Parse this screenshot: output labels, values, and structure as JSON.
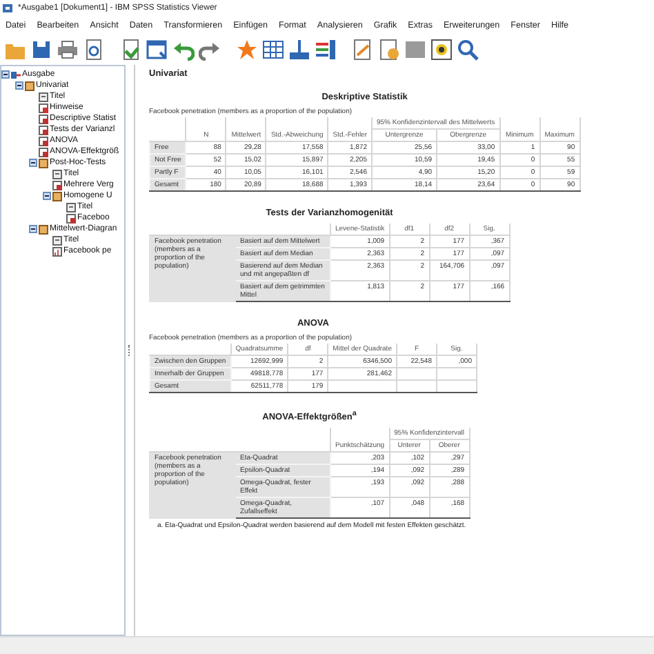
{
  "window": {
    "title": "*Ausgabe1 [Dokument1] - IBM SPSS Statistics Viewer"
  },
  "menu": [
    "Datei",
    "Bearbeiten",
    "Ansicht",
    "Daten",
    "Transformieren",
    "Einfügen",
    "Format",
    "Analysieren",
    "Grafik",
    "Extras",
    "Erweiterungen",
    "Fenster",
    "Hilfe"
  ],
  "outline": [
    {
      "label": "Ausgabe",
      "kind": "root",
      "expanded": true,
      "children": [
        {
          "label": "Univariat",
          "kind": "folder",
          "expanded": true,
          "children": [
            {
              "label": "Titel",
              "kind": "title"
            },
            {
              "label": "Hinweise",
              "kind": "notes"
            },
            {
              "label": "Descriptive Statist",
              "kind": "table"
            },
            {
              "label": "Tests der Varianzl",
              "kind": "table"
            },
            {
              "label": "ANOVA",
              "kind": "table"
            },
            {
              "label": "ANOVA-Effektgröß",
              "kind": "table"
            },
            {
              "label": "Post-Hoc-Tests",
              "kind": "folder",
              "expanded": true,
              "children": [
                {
                  "label": "Titel",
                  "kind": "title"
                },
                {
                  "label": "Mehrere Verg",
                  "kind": "table"
                },
                {
                  "label": "Homogene U",
                  "kind": "folder",
                  "expanded": true,
                  "children": [
                    {
                      "label": "Titel",
                      "kind": "title"
                    },
                    {
                      "label": "Faceboo",
                      "kind": "table"
                    }
                  ]
                }
              ]
            },
            {
              "label": "Mittelwert-Diagran",
              "kind": "folder",
              "expanded": true,
              "children": [
                {
                  "label": "Titel",
                  "kind": "title"
                },
                {
                  "label": "Facebook pe",
                  "kind": "chart"
                }
              ]
            }
          ]
        }
      ]
    }
  ],
  "output": {
    "heading": "Univariat",
    "tables": [
      {
        "title": "Deskriptive Statistik",
        "caption": "Facebook penetration (members as a proportion of the population)",
        "columns": [
          {
            "label": "N"
          },
          {
            "label": "Mittelwert"
          },
          {
            "label": "Std.-Abweichung"
          },
          {
            "label": "Std.-Fehler"
          },
          {
            "label": "95% Konfidenzintervall des Mittelwerts",
            "sub": [
              "Untergrenze",
              "Obergrenze"
            ]
          },
          {
            "label": "Minimum"
          },
          {
            "label": "Maximum"
          }
        ],
        "rows": [
          {
            "label": "Free",
            "values": [
              "88",
              "29,28",
              "17,558",
              "1,872",
              "25,56",
              "33,00",
              "1",
              "90"
            ]
          },
          {
            "label": "Not Free",
            "values": [
              "52",
              "15,02",
              "15,897",
              "2,205",
              "10,59",
              "19,45",
              "0",
              "55"
            ]
          },
          {
            "label": "Partly F",
            "values": [
              "40",
              "10,05",
              "16,101",
              "2,546",
              "4,90",
              "15,20",
              "0",
              "59"
            ]
          },
          {
            "label": "Gesamt",
            "values": [
              "180",
              "20,89",
              "18,688",
              "1,393",
              "18,14",
              "23,64",
              "0",
              "90"
            ]
          }
        ]
      },
      {
        "title": "Tests der Varianzhomogenität",
        "columns": [
          {
            "label": "Levene-Statistik"
          },
          {
            "label": "df1"
          },
          {
            "label": "df2"
          },
          {
            "label": "Sig."
          }
        ],
        "group": {
          "label": "Facebook penetration (members as a proportion of the population)",
          "rows": [
            {
              "label": "Basiert auf dem Mittelwert",
              "values": [
                "1,009",
                "2",
                "177",
                ",367"
              ]
            },
            {
              "label": "Basiert auf dem Median",
              "values": [
                "2,363",
                "2",
                "177",
                ",097"
              ]
            },
            {
              "label": "Basierend auf dem Median und mit angepaßten df",
              "values": [
                "2,363",
                "2",
                "164,706",
                ",097"
              ]
            },
            {
              "label": "Basiert auf dem getrimmten Mittel",
              "values": [
                "1,813",
                "2",
                "177",
                ",166"
              ]
            }
          ]
        }
      },
      {
        "title": "ANOVA",
        "caption": "Facebook penetration (members as a proportion of the population)",
        "columns": [
          {
            "label": "Quadratsumme"
          },
          {
            "label": "df"
          },
          {
            "label": "Mittel der Quadrate"
          },
          {
            "label": "F"
          },
          {
            "label": "Sig."
          }
        ],
        "rows": [
          {
            "label": "Zwischen den Gruppen",
            "values": [
              "12692,999",
              "2",
              "6346,500",
              "22,548",
              ",000"
            ]
          },
          {
            "label": "Innerhalb der Gruppen",
            "values": [
              "49818,778",
              "177",
              "281,462"
            ]
          },
          {
            "label": "Gesamt",
            "values": [
              "62511,778",
              "179"
            ]
          }
        ]
      },
      {
        "title": "ANOVA-Effektgrößen$^{a}$",
        "columns": [
          {
            "label": "Punktschätzung"
          },
          {
            "label": "95% Konfidenzintervall",
            "sub": [
              "Unterer",
              "Oberer"
            ]
          }
        ],
        "group": {
          "label": "Facebook penetration (members as a proportion of the population)",
          "rows": [
            {
              "label": "Eta-Quadrat",
              "values": [
                ",203",
                ",102",
                ",297"
              ]
            },
            {
              "label": "Epsilon-Quadrat",
              "values": [
                ",194",
                ",092",
                ",289"
              ]
            },
            {
              "label": "Omega-Quadrat, fester Effekt",
              "values": [
                ",193",
                ",092",
                ",288"
              ]
            },
            {
              "label": "Omega-Quadrat, Zufallseffekt",
              "values": [
                ",107",
                ",048",
                ",168"
              ]
            }
          ]
        },
        "footnote": "a. Eta-Quadrat und Epsilon-Quadrat werden basierend auf dem Modell mit festen Effekten geschätzt."
      }
    ]
  }
}
